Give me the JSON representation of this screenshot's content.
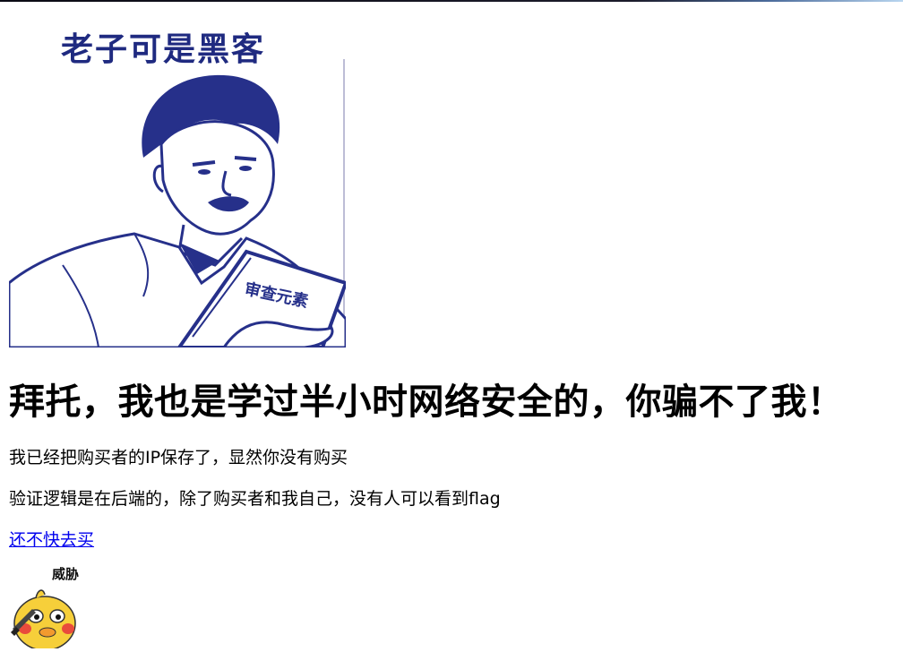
{
  "meme_main": {
    "caption": "老子可是黑客",
    "book_text": "审查元素"
  },
  "headline": "拜托，我也是学过半小时网络安全的，你骗不了我！",
  "message_1": "我已经把购买者的IP保存了，显然你没有购买",
  "message_2": "验证逻辑是在后端的，除了购买者和我自己，没有人可以看到flag",
  "buy_link": "还不快去买",
  "meme_duck": {
    "label": "威胁"
  },
  "colors": {
    "meme_ink": "#1f2a80",
    "link": "#0000ee"
  }
}
